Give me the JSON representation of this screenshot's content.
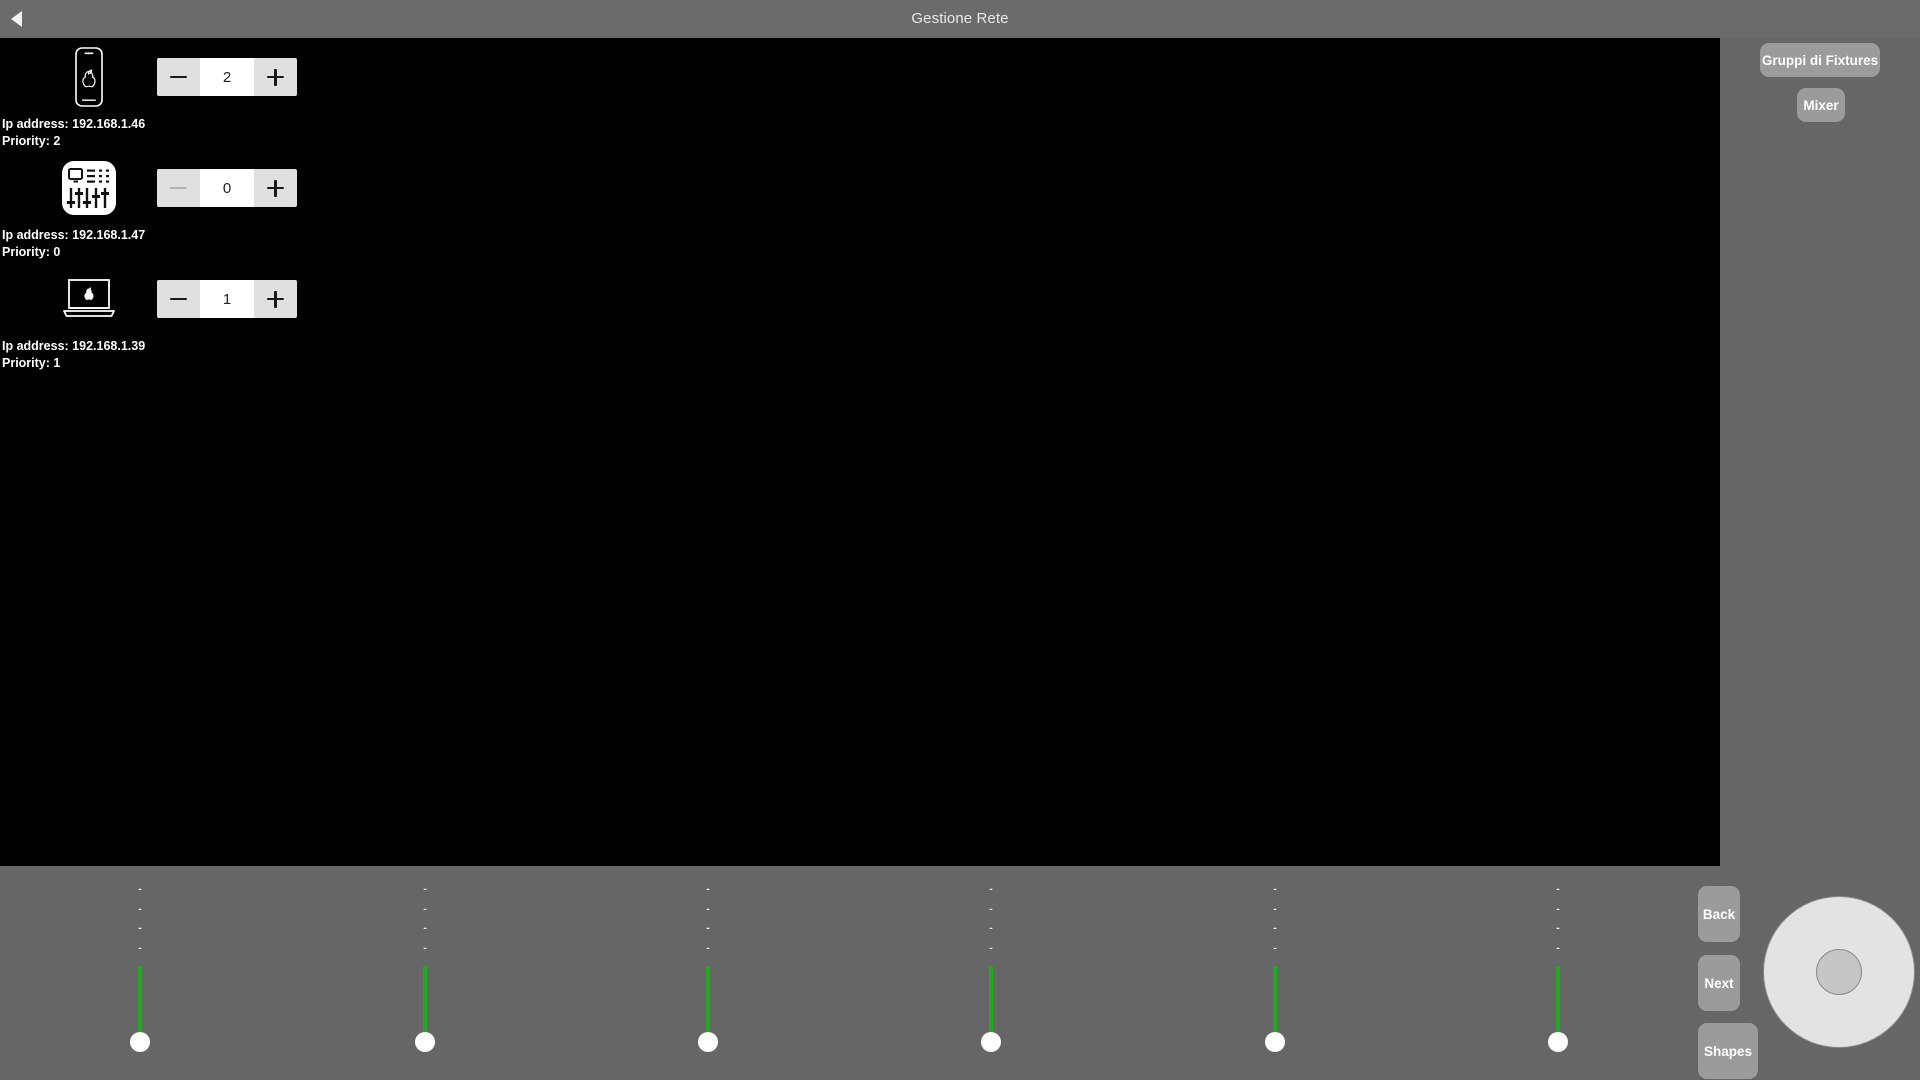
{
  "window": {
    "title": "Gestione Rete",
    "back_icon": "back-triangle-icon"
  },
  "theme": {
    "chrome_gray": "#6b6b6b",
    "canvas_black": "#000000",
    "button_gray": "#9b9b9b",
    "fader_green": "#22aa22",
    "stepper_button": "#e0e0e0",
    "stepper_value_bg": "#ffffff"
  },
  "devices": [
    {
      "icon": "iphone-icon",
      "priority_value": "2",
      "minus_label": "−",
      "plus_label": "+",
      "minus_enabled": true,
      "ip_line": "Ip address: 192.168.1.46",
      "priority_line": "Priority: 2"
    },
    {
      "icon": "mixer-console-icon",
      "priority_value": "0",
      "minus_label": "−",
      "plus_label": "+",
      "minus_enabled": false,
      "ip_line": "Ip address: 192.168.1.47",
      "priority_line": "Priority: 0"
    },
    {
      "icon": "macbook-icon",
      "priority_value": "1",
      "minus_label": "−",
      "plus_label": "+",
      "minus_enabled": true,
      "ip_line": "Ip address: 192.168.1.39",
      "priority_line": "Priority: 1"
    }
  ],
  "toolbar": {
    "fixture_groups_label": "Gruppi di Fixtures",
    "mixer_label": "Mixer"
  },
  "transport": {
    "back_label": "Back",
    "next_label": "Next",
    "shapes_label": "Shapes",
    "jogwheel_icon": "jog-wheel-icon"
  },
  "faders": [
    {
      "labels": [
        "-",
        "-",
        "-",
        "-"
      ],
      "value_pct": 0
    },
    {
      "labels": [
        "-",
        "-",
        "-",
        "-"
      ],
      "value_pct": 0
    },
    {
      "labels": [
        "-",
        "-",
        "-",
        "-"
      ],
      "value_pct": 0
    },
    {
      "labels": [
        "-",
        "-",
        "-",
        "-"
      ],
      "value_pct": 0
    },
    {
      "labels": [
        "-",
        "-",
        "-",
        "-"
      ],
      "value_pct": 0
    },
    {
      "labels": [
        "-",
        "-",
        "-",
        "-"
      ],
      "value_pct": 0
    }
  ]
}
